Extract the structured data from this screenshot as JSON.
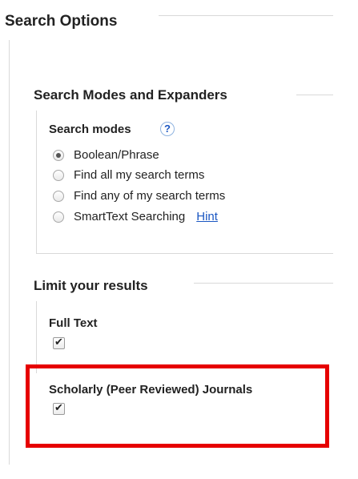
{
  "search_options": {
    "title": "Search Options"
  },
  "modes_expanders": {
    "title": "Search Modes and Expanders",
    "search_modes_label": "Search modes",
    "help_glyph": "?",
    "options": [
      {
        "label": "Boolean/Phrase",
        "checked": true
      },
      {
        "label": "Find all my search terms",
        "checked": false
      },
      {
        "label": "Find any of my search terms",
        "checked": false
      },
      {
        "label": "SmartText Searching",
        "checked": false
      }
    ],
    "hint_link": "Hint"
  },
  "limits": {
    "title": "Limit your results",
    "full_text": {
      "label": "Full Text",
      "checked": true
    },
    "scholarly": {
      "label": "Scholarly (Peer Reviewed) Journals",
      "checked": true
    }
  },
  "colors": {
    "highlight": "#e60000",
    "link": "#1a56c2",
    "rule": "#d9d9d9"
  },
  "icons": {
    "help": "help-icon",
    "check": "checkmark-icon"
  }
}
